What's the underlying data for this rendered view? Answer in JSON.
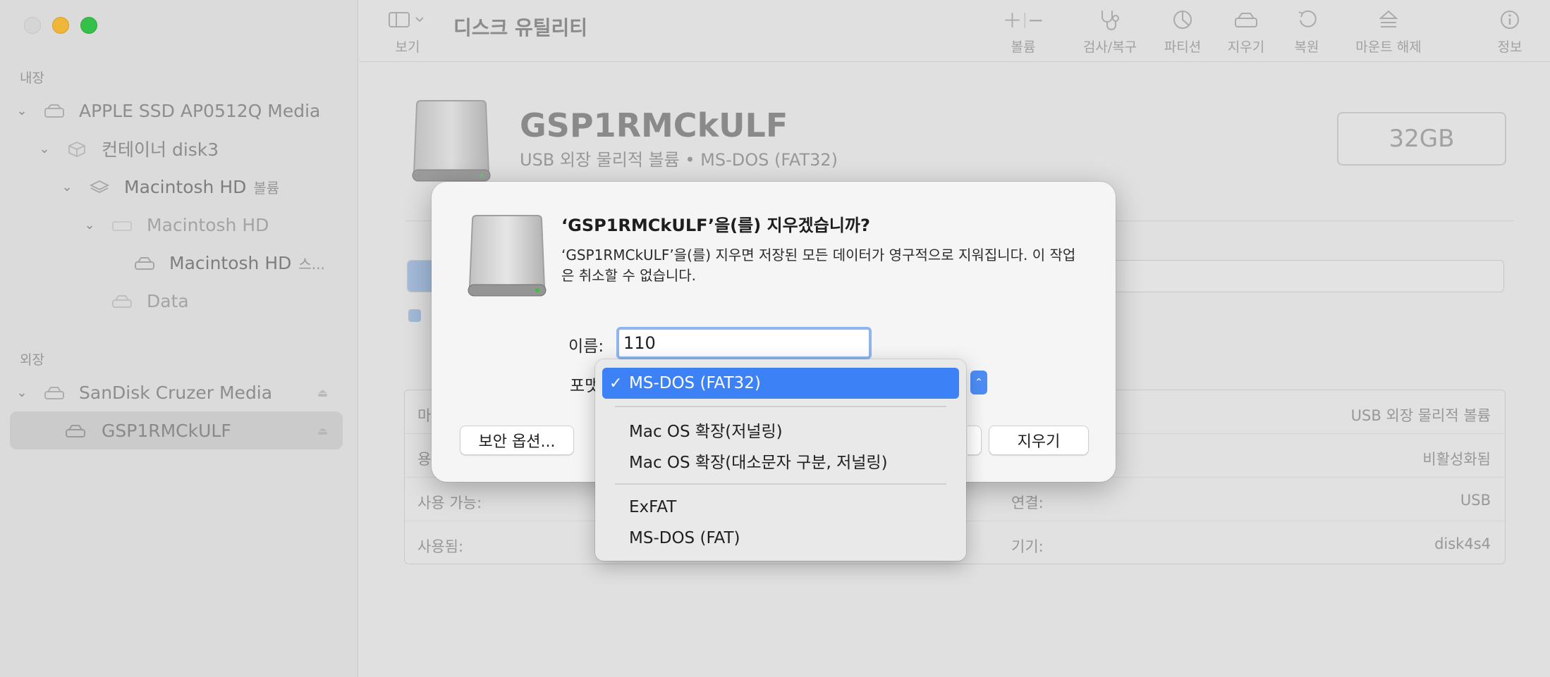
{
  "app": {
    "title": "디스크 유틸리티"
  },
  "sidebar": {
    "internal_label": "내장",
    "external_label": "외장",
    "items": [
      {
        "label": "APPLE SSD AP0512Q Media",
        "sub": ""
      },
      {
        "label": "컨테이너 disk3",
        "sub": ""
      },
      {
        "label": "Macintosh HD",
        "sub": "볼륨"
      },
      {
        "label": "Macintosh HD",
        "sub": ""
      },
      {
        "label": "Macintosh HD",
        "sub": "스..."
      },
      {
        "label": "Data",
        "sub": ""
      },
      {
        "label": "SanDisk Cruzer Media",
        "sub": ""
      },
      {
        "label": "GSP1RMCkULF",
        "sub": ""
      }
    ]
  },
  "toolbar": {
    "view_label": "보기",
    "volume_label": "볼륨",
    "firstaid_label": "검사/복구",
    "partition_label": "파티션",
    "erase_label": "지우기",
    "restore_label": "복원",
    "unmount_label": "마운트 해제",
    "info_label": "정보"
  },
  "disk": {
    "name": "GSP1RMCkULF",
    "subtitle": "USB 외장 물리적 볼륨 • MS-DOS (FAT32)",
    "capacity": "32GB"
  },
  "info_table": {
    "rows": [
      {
        "key": "마",
        "key2": "",
        "value": "USB 외장 물리적 볼륨"
      },
      {
        "key": "용",
        "key2": "",
        "value": "비활성화됨"
      },
      {
        "key": "사용 가능:",
        "key2": "연결:",
        "value": "USB"
      },
      {
        "key": "사용됨:",
        "key2": "기기:",
        "value": "disk4s4"
      }
    ]
  },
  "dialog": {
    "title": "‘GSP1RMCkULF’을(를) 지우겠습니까?",
    "message": "‘GSP1RMCkULF’을(를) 지우면 저장된 모든 데이터가 영구적으로 지워집니다. 이 작업은 취소할 수 없습니다.",
    "name_label": "이름:",
    "name_value": "110",
    "format_label": "포맷",
    "security_button": "보안 옵션...",
    "erase_button": "지우기"
  },
  "format_menu": {
    "selected": "MS-DOS (FAT32)",
    "items": [
      "MS-DOS (FAT32)",
      "Mac OS 확장(저널링)",
      "Mac OS 확장(대소문자 구분, 저널링)",
      "ExFAT",
      "MS-DOS (FAT)"
    ]
  },
  "colors": {
    "accent": "#3c82f6",
    "traffic_close": "#e0e0e0",
    "traffic_min": "#fdbc2e",
    "traffic_max": "#28c840"
  }
}
